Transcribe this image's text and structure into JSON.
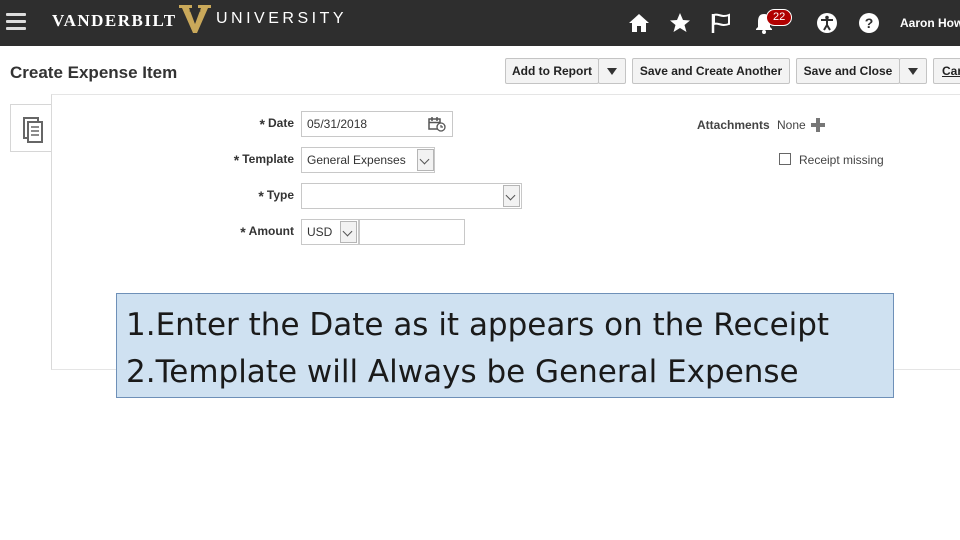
{
  "header": {
    "brand_left": "VANDERBILT",
    "brand_right": "UNIVERSITY",
    "notification_count": "22",
    "user_name": "Aaron How",
    "icons": [
      "menu-icon",
      "home-icon",
      "star-icon",
      "flag-icon",
      "bell-icon",
      "accessibility-icon",
      "help-icon"
    ]
  },
  "page": {
    "title": "Create Expense Item"
  },
  "toolbar": {
    "add_to_report": "Add to Report",
    "save_and_create_another": "Save and Create Another",
    "save_and_close": "Save and Close",
    "cancel": "Can"
  },
  "form": {
    "required_mark": "*",
    "date_label": "Date",
    "date_value": "05/31/2018",
    "template_label": "Template",
    "template_value": "General Expenses",
    "type_label": "Type",
    "type_value": "",
    "amount_label": "Amount",
    "currency_value": "USD",
    "amount_value": "",
    "attachments_label": "Attachments",
    "attachments_value": "None",
    "receipt_missing_label": "Receipt missing",
    "receipt_missing_checked": false
  },
  "callout": {
    "line1": "1.Enter the Date as it appears on the Receipt",
    "line2": "2.Template will Always be General Expense"
  },
  "colors": {
    "header_bg": "#2e2e2e",
    "badge": "#b00000",
    "callout_bg": "#cfe1f1",
    "callout_border": "#6e90b8"
  }
}
